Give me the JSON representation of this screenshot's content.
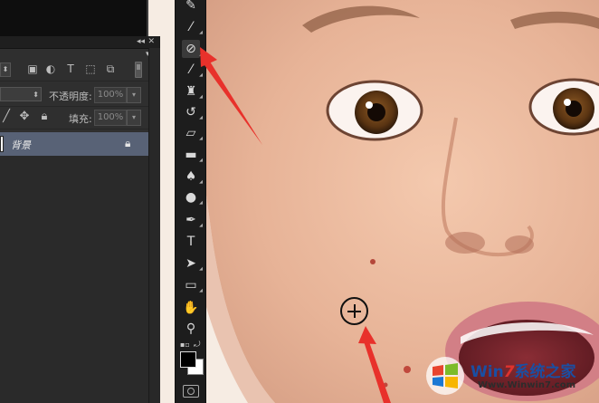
{
  "layers_panel": {
    "collapse_icon": "double-chevron-icon",
    "close_icon": "close-icon",
    "menu_icon": "panel-menu-icon",
    "filter_icons": [
      "image-filter-icon",
      "adjustment-filter-icon",
      "type-filter-icon",
      "shape-filter-icon",
      "smart-object-filter-icon"
    ],
    "filter_type_glyph": "T",
    "blend_mode_value": "",
    "opacity_label": "不透明度:",
    "opacity_value": "100%",
    "fill_label": "填充:",
    "fill_value": "100%",
    "lock_icons": [
      "lock-pixels-brush-icon",
      "lock-position-move-icon"
    ],
    "layer": {
      "name": "背景",
      "lock_icon": "lock-icon",
      "selected_color": "#586276"
    }
  },
  "toolbar": {
    "tools": [
      "brush-dropper-icon",
      "eyedropper-icon",
      "spot-healing-brush-icon",
      "brush-icon",
      "clone-stamp-icon",
      "history-brush-icon",
      "eraser-icon",
      "gradient-icon",
      "blur-icon",
      "dodge-icon",
      "pen-icon",
      "type-icon",
      "path-selection-icon",
      "rectangle-icon",
      "hand-icon",
      "zoom-icon"
    ],
    "type_glyph": "T",
    "active_tool": "spot-healing-brush-icon",
    "foreground_color": "#000000",
    "background_color": "#ffffff"
  },
  "canvas": {
    "cursor_icon": "healing-brush-cursor-icon",
    "annotation_color": "#e8312b"
  },
  "watermark": {
    "title_prefix": "Win",
    "title_seven": "7",
    "title_suffix": "系统之家",
    "url": "Www.Winwin7.com"
  }
}
